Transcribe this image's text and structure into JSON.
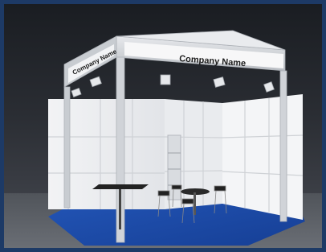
{
  "scene": {
    "subject": "exhibition-booth",
    "front_sign_text": "Company Name",
    "side_sign_text": "Company Name",
    "colors": {
      "background_border": "#1d3a66",
      "carpet": "#1f4aa8",
      "walls": "#eef0f2",
      "frame": "#d7dade"
    }
  }
}
